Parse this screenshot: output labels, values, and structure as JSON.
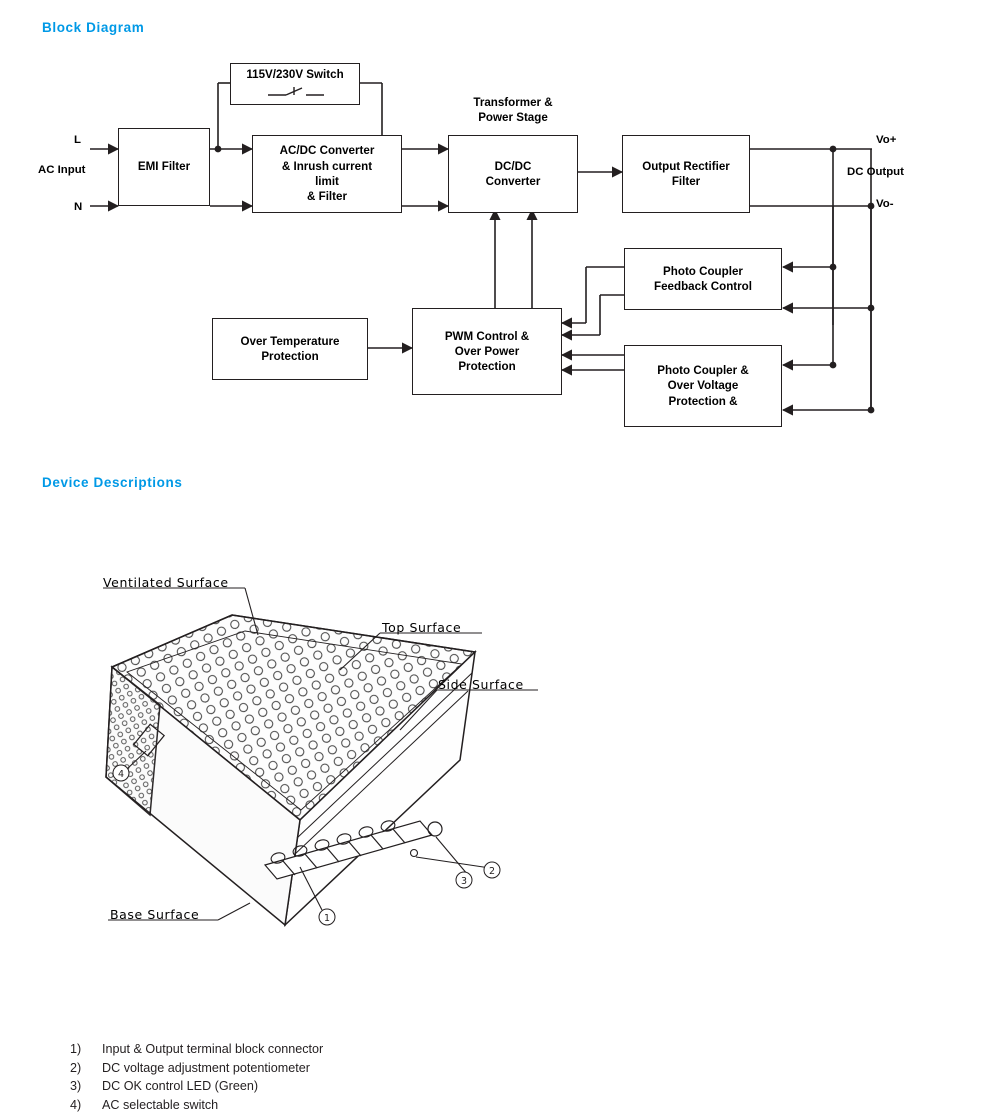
{
  "sections": {
    "block_diagram_title": "Block Diagram",
    "device_descriptions_title": "Device Descriptions"
  },
  "block_diagram": {
    "blocks": [
      {
        "id": "emi-filter",
        "label": "EMI Filter"
      },
      {
        "id": "acdc-converter",
        "label": "AC/DC Converter\n& Inrush current\nlimit\n& Filter"
      },
      {
        "id": "dcdc-converter",
        "label": "DC/DC\nConverter"
      },
      {
        "id": "output-rectifier-filter",
        "label": "Output Rectifier\nFilter"
      },
      {
        "id": "photo-coupler-feedback",
        "label": "Photo Coupler\nFeedback Control"
      },
      {
        "id": "photo-coupler-ovp",
        "label": "Photo Coupler &\nOver Voltage\nProtection &"
      },
      {
        "id": "pwm-control",
        "label": "PWM Control &\nOver Power\nProtection"
      },
      {
        "id": "over-temperature-protection",
        "label": "Over Temperature\nProtection"
      },
      {
        "id": "voltage-switch",
        "label": "115V/230V Switch"
      }
    ],
    "labels": {
      "transformer_power_stage": "Transformer &\nPower Stage",
      "line": "L",
      "neutral": "N",
      "ac_input": "AC Input",
      "vo_plus": "Vo+",
      "vo_minus": "Vo-",
      "dc_output": "DC Output"
    }
  },
  "device_description": {
    "labels": {
      "ventilated_surface": "Ventilated  Surface",
      "top_surface": "Top  Surface",
      "side_surface": "Side  Surface",
      "base_surface": "Base  Surface"
    },
    "callouts": [
      "①",
      "②",
      "③",
      "④"
    ],
    "legend": [
      {
        "num": "1)",
        "text": "Input & Output terminal block connector"
      },
      {
        "num": "2)",
        "text": "DC voltage adjustment potentiometer"
      },
      {
        "num": "3)",
        "text": "DC OK control LED (Green)"
      },
      {
        "num": "4)",
        "text": "AC selectable switch"
      }
    ]
  },
  "colors": {
    "accent": "#0099e6",
    "line": "#231f20"
  }
}
